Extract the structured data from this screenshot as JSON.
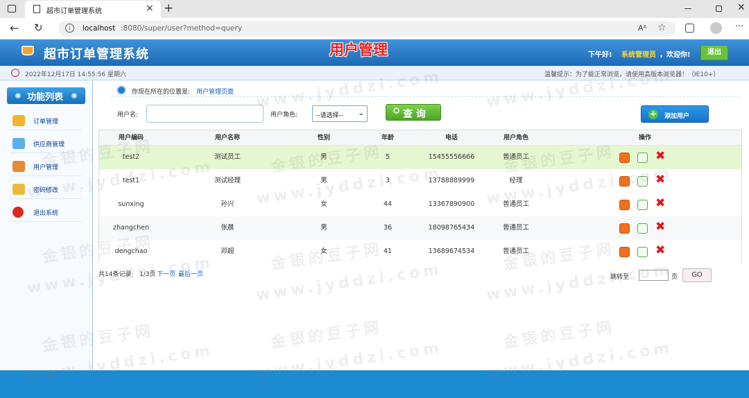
{
  "browser": {
    "tab_title": "超市订单管理系统",
    "new_tab": "+",
    "url_host": "localhost",
    "url_rest": ":8080/super/user?method=query",
    "read_aloud": "Aᴬ"
  },
  "header": {
    "app_title": "超市订单管理系统",
    "page_title": "用户管理",
    "greeting": "下午好!",
    "user_role": "系统管理员",
    "welcome": "，欢迎你!",
    "logout": "退出"
  },
  "infobar": {
    "datetime": "2022年12月17日 14:55:56 星期六",
    "tip": "温馨提示：为了能正常浏览，请使用高版本浏览器！（IE10+）"
  },
  "sidebar": {
    "title": "功能列表",
    "items": [
      {
        "label": "订单管理"
      },
      {
        "label": "供应商管理"
      },
      {
        "label": "用户管理"
      },
      {
        "label": "密码修改"
      },
      {
        "label": "退出系统"
      }
    ]
  },
  "breadcrumb": {
    "prefix": "你现在所在的位置是:",
    "current": "用户管理页面"
  },
  "search": {
    "name_label": "用户名:",
    "name_value": "",
    "role_label": "用户角色:",
    "role_selected": "--请选择--",
    "query_button": "查 询",
    "add_button": "添加用户"
  },
  "table": {
    "headers": [
      "用户编码",
      "用户名称",
      "性别",
      "年龄",
      "电话",
      "用户角色",
      "操作"
    ],
    "rows": [
      {
        "code": "test2",
        "name": "测试员工",
        "gender": "男",
        "age": "5",
        "phone": "15455556666",
        "role": "普通员工"
      },
      {
        "code": "test1",
        "name": "测试经理",
        "gender": "男",
        "age": "3",
        "phone": "13788889999",
        "role": "经理"
      },
      {
        "code": "sunxing",
        "name": "孙兴",
        "gender": "女",
        "age": "44",
        "phone": "13367890900",
        "role": "普通员工"
      },
      {
        "code": "zhangchen",
        "name": "张晨",
        "gender": "男",
        "age": "36",
        "phone": "18098765434",
        "role": "普通员工"
      },
      {
        "code": "dengchao",
        "name": "邓超",
        "gender": "女",
        "age": "41",
        "phone": "13689674534",
        "role": "普通员工"
      }
    ]
  },
  "pagination": {
    "total": "共14条记录",
    "page_info": "1/3页",
    "next": "下一页",
    "last": "最后一页",
    "jump_label": "跳转至",
    "jump_value": "",
    "page_suffix": "页",
    "go": "GO"
  },
  "watermark": {
    "cn": "金银的豆子网",
    "url": "www.jyddzi.com"
  },
  "colors": {
    "header_blue": "#2a7cc7",
    "selected_row": "#e5f7d0",
    "query_green": "#5cb531",
    "footer_blue": "#1d8bd1",
    "delete_red": "#e0141c"
  }
}
